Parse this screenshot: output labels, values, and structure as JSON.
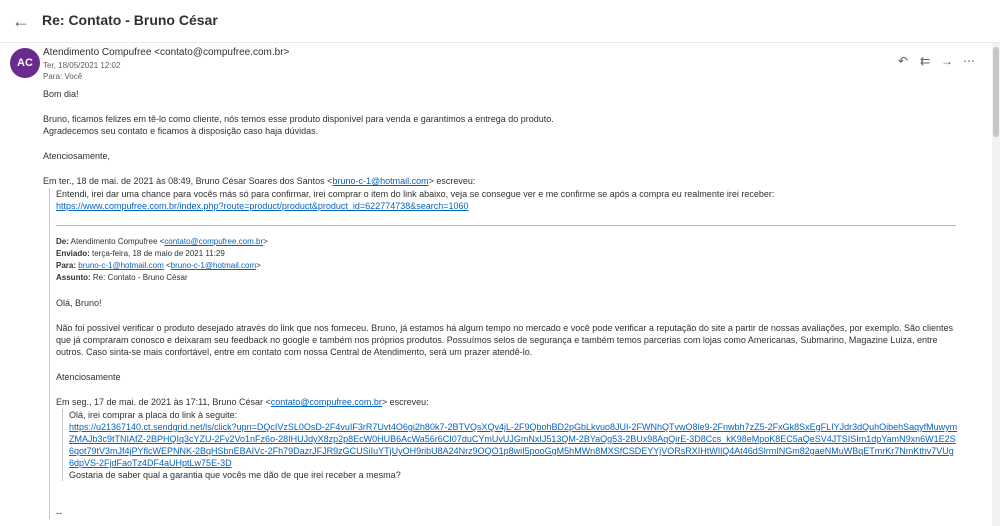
{
  "header": {
    "subject": "Re: Contato - Bruno César"
  },
  "message": {
    "avatar_initials": "AC",
    "sender": "Atendimento Compufree <contato@compufree.com.br>",
    "date": "Ter, 18/05/2021 12:02",
    "to": "Para:  Você",
    "greeting": "Bom dia!",
    "para1_line1": "Bruno, ficamos felizes em tê-lo como cliente, nós temos esse produto disponível para venda e garantimos a entrega do produto.",
    "para1_line2": "Agradecemos seu contato e ficamos à disposição caso haja dúvidas.",
    "signoff": "Atenciosamente,",
    "quote_intro_prefix": "Em ter., 18 de mai. de 2021 às 08:49, Bruno César Soares dos Santos <",
    "quote_intro_email": "bruno-c-1@hotmail.com",
    "quote_intro_suffix": "> escreveu:",
    "quote_text": "Entendi, irei dar uma chance para vocês más só para confirmar, irei comprar o item do link abaixo, veja se consegue ver e me confirme se após a compra eu realmente irei receber:",
    "quote_link": "https://www.compufree.com.br/index.php?route=product/product&product_id=622774738&search=1060",
    "fwd": {
      "de_label": "De:",
      "de_name": " Atendimento Compufree <",
      "de_email": "contato@compufree.com.br",
      "de_end": ">",
      "enviado_label": "Enviado:",
      "enviado_value": " terça-feira, 18 de maio de 2021 11:29",
      "para_label": "Para:",
      "para_email1": "bruno-c-1@hotmail.com",
      "para_mid": " <",
      "para_email2": "bruno-c-1@hotmail.com",
      "para_end": ">",
      "assunto_label": "Assunto:",
      "assunto_value": " Re: Contato - Bruno César"
    },
    "ola": "Olá, Bruno!",
    "para2": "Não foi possível verificar o produto desejado através do link que nos forneceu. Bruno, já estamos há algum tempo no mercado e você pode verificar a reputação do site a partir de nossas avaliações, por exemplo. São clientes que já compraram conosco e deixaram seu feedback no google e também nos próprios produtos. Possuímos selos de segurança e também temos parcerias com lojas como Americanas, Submarino, Magazine Luiza, entre outros. Caso sinta-se mais confortável, entre em contato com nossa Central de Atendimento, será um prazer atendê-lo.",
    "signoff2": "Atenciosamente",
    "quote2_intro_prefix": "Em seg., 17 de mai. de 2021 às 17:11, Bruno César <",
    "quote2_intro_email": "contato@compufree.com.br",
    "quote2_intro_suffix": "> escreveu:",
    "quote2_line1": "Olá, irei comprar a placa do link à seguite:",
    "quote2_link": "https://u21367140.ct.sendgrid.net/ls/click?upn=DQcIVzSL0OsD-2F4vuIF3rR7Uvt4O6gi2h80k7-2BTVQsXQv4jL-2F9QbohBD2pGbLkvuo8JUI-2FWNhQTvwO8le9-2Fnwbh7zZ5-2FxGk8SxEgFLIYJdr3dQuhOibehSaqyfMuwymZMAJb3c9tTNIAfZ-2BPHQIq3cYZU-2Fv2Vo1nFz6o-28IHUJdyX8zp2p8EcW0HUB6AcWa56r6CI07duCYmUvUJGmNxIJ513QM-2BYaQg53-2BUx98AqQirE-3D8Ccs_kK98eMpoK8EC5aQeSV4JTSISIm1dpYamN9xn6W1E2S6qot79tV3mJf4jPYflcWEPNNK-2BqHSbnEBAIVc-2Fh79DazrJFJR9zGCUSiIuYTjUyOH9ribU8A24Nrz9OQO1p8wiI5pooGgM5hMWn8MXSfCSDEYYjVORsRXIHtWIlQ4At46dSlrmINGm82gaeNMuWBqETmrKr7NmKthv7VUg6dpVS-2FjdFaoTz4DF4aUHptLw75E-3D",
    "quote2_line2": "Gostaria de saber qual a garantia que vocês me dão de que irei receber a mesma?",
    "dashes": "--"
  }
}
